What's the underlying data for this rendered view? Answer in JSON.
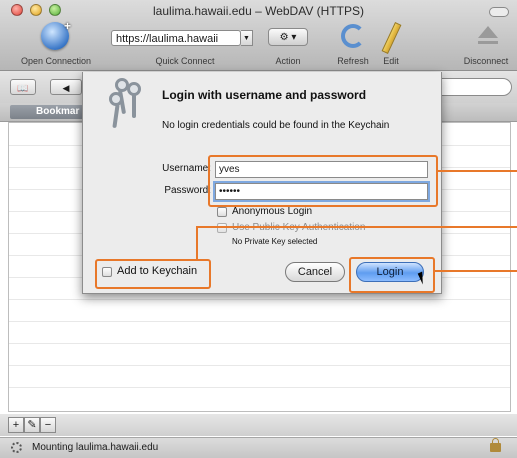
{
  "window": {
    "title": "laulima.hawaii.edu – WebDAV (HTTPS)"
  },
  "toolbar": {
    "open_connection_label": "Open Connection",
    "url_value": "https://laulima.hawaii",
    "quick_connect_label": "Quick Connect",
    "action_label": "Action",
    "refresh_label": "Refresh",
    "edit_label": "Edit",
    "disconnect_label": "Disconnect"
  },
  "browser": {
    "tab_label": "Bookmar"
  },
  "dialog": {
    "title": "Login with username and password",
    "message": "No login credentials could be found in the Keychain",
    "username_label": "Username:",
    "username_value": "yves",
    "password_label": "Password:",
    "password_value": "••••••",
    "anonymous_label": "Anonymous Login",
    "public_key_label": "Use Public Key Authentication",
    "private_key_note": "No Private Key selected",
    "add_keychain_label": "Add to Keychain",
    "cancel_label": "Cancel",
    "login_label": "Login"
  },
  "bottom": {
    "add_symbol": "+",
    "edit_symbol": "✎",
    "remove_symbol": "−"
  },
  "status": {
    "text": "Mounting laulima.hawaii.edu"
  },
  "colors": {
    "annotation": "#e8782a",
    "default_button": "#5f9df0"
  },
  "icons": [
    "globe-icon",
    "dropdown-arrow-icon",
    "gear-icon",
    "refresh-icon",
    "pencil-icon",
    "eject-icon",
    "keys-icon",
    "spinner-icon",
    "lock-icon",
    "cursor-icon"
  ]
}
